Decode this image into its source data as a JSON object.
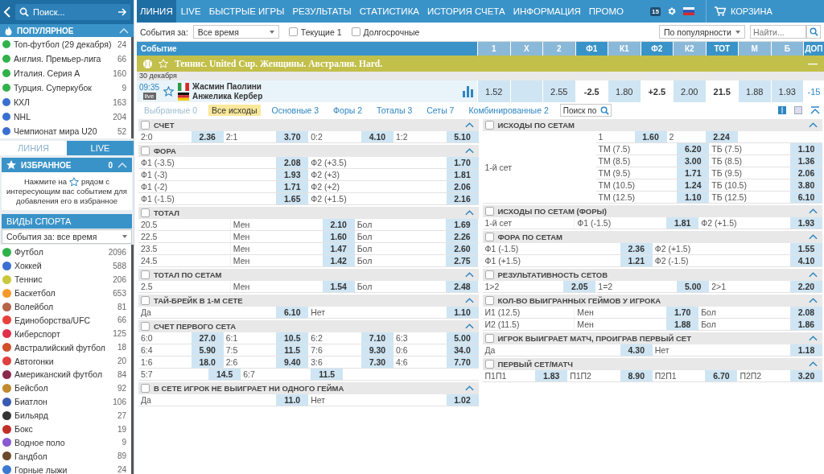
{
  "sidebar": {
    "search": {
      "placeholder": "Поиск..."
    },
    "popular": {
      "title": "ПОПУЛЯРНОЕ",
      "expanded": true,
      "items": [
        {
          "name": "Топ-футбол (29 декабря)",
          "count": "24",
          "color": "#2fb24a"
        },
        {
          "name": "Англия. Премьер-лига",
          "count": "66",
          "color": "#2fb24a"
        },
        {
          "name": "Италия. Серия А",
          "count": "160",
          "color": "#2fb24a"
        },
        {
          "name": "Турция. Суперкубок",
          "count": "9",
          "color": "#2fb24a"
        },
        {
          "name": "КХЛ",
          "count": "163",
          "color": "#3a6fd0"
        },
        {
          "name": "NHL",
          "count": "204",
          "color": "#3a6fd0"
        },
        {
          "name": "Чемпионат мира U20",
          "count": "52",
          "color": "#3a6fd0"
        }
      ]
    },
    "tabs": [
      {
        "label": "ЛИНИЯ",
        "selected": true
      },
      {
        "label": "LIVE",
        "selected": false
      }
    ],
    "favorites": {
      "title": "ИЗБРАННОЕ",
      "count": "0",
      "expanded": true,
      "hint_before": "Нажмите на",
      "hint_middle": "рядом с",
      "hint_after": "интересующим вас событием для добавления его в избранное"
    },
    "sports": {
      "title": "ВИДЫ СПОРТА",
      "period": "События за: все время",
      "items": [
        {
          "name": "Футбол",
          "count": "2096",
          "color": "#2fb24a"
        },
        {
          "name": "Хоккей",
          "count": "588",
          "color": "#3a6fd0"
        },
        {
          "name": "Теннис",
          "count": "206",
          "color": "#c8c83a"
        },
        {
          "name": "Баскетбол",
          "count": "653",
          "color": "#f59a2a"
        },
        {
          "name": "Волейбол",
          "count": "81",
          "color": "#b5654a"
        },
        {
          "name": "Единоборства/UFC",
          "count": "66",
          "color": "#e8403a"
        },
        {
          "name": "Киберспорт",
          "count": "125",
          "color": "#e0304a"
        },
        {
          "name": "Австралийский футбол",
          "count": "18",
          "color": "#d0502a"
        },
        {
          "name": "Автогонки",
          "count": "20",
          "color": "#e04040"
        },
        {
          "name": "Американский футбол",
          "count": "84",
          "color": "#8a2a4a"
        },
        {
          "name": "Бейсбол",
          "count": "92",
          "color": "#c08a30"
        },
        {
          "name": "Биатлон",
          "count": "106",
          "color": "#3a5ab0"
        },
        {
          "name": "Бильярд",
          "count": "27",
          "color": "#333333"
        },
        {
          "name": "Бокс",
          "count": "19",
          "color": "#c0302a"
        },
        {
          "name": "Водное поло",
          "count": "9",
          "color": "#8a5ad0"
        },
        {
          "name": "Гандбол",
          "count": "89",
          "color": "#6a4a2a"
        },
        {
          "name": "Горные лыжи",
          "count": "24",
          "color": "#3a7ad0"
        }
      ]
    }
  },
  "nav": {
    "items": [
      {
        "label": "ЛИНИЯ",
        "selected": true
      },
      {
        "label": "LIVE",
        "selected": false
      },
      {
        "label": "БЫСТРЫЕ ИГРЫ",
        "selected": false
      },
      {
        "label": "РЕЗУЛЬТАТЫ",
        "selected": false
      },
      {
        "label": "СТАТИСТИКА",
        "selected": false
      },
      {
        "label": "ИСТОРИЯ СЧЕТА",
        "selected": false
      },
      {
        "label": "ИНФОРМАЦИЯ",
        "selected": false
      },
      {
        "label": "ПРОМО",
        "selected": false
      }
    ],
    "date_badge": "15",
    "cart": "КОРЗИНА"
  },
  "filter": {
    "period_label": "События за:",
    "period": "Все время",
    "checks": [
      {
        "label": "Текущие 1",
        "checked": false
      },
      {
        "label": "Долгосрочные",
        "checked": false
      }
    ],
    "sort": "По популярности",
    "search_placeholder": "Найти..."
  },
  "table": {
    "event_header": "Событие",
    "columns": [
      {
        "label": "1",
        "kind": "odd"
      },
      {
        "label": "X",
        "kind": "odd"
      },
      {
        "label": "2",
        "kind": "odd"
      },
      {
        "label": "Ф1",
        "kind": "param"
      },
      {
        "label": "К1",
        "kind": "odd"
      },
      {
        "label": "Ф2",
        "kind": "param"
      },
      {
        "label": "К2",
        "kind": "odd"
      },
      {
        "label": "ТОТ",
        "kind": "param"
      },
      {
        "label": "М",
        "kind": "odd"
      },
      {
        "label": "Б",
        "kind": "odd"
      },
      {
        "label": "ДОП",
        "kind": "param"
      }
    ],
    "league": {
      "title": "Теннис. United Cup. Женщины. Австралия. Hard.",
      "collapse": "—"
    },
    "date": "30 декабря",
    "event": {
      "time": "09:35",
      "live": "live",
      "team1": "Жасмин Паолини",
      "team2": "Анжелика Кербер",
      "cells": [
        {
          "text": "1.52",
          "kind": "odd"
        },
        {
          "kind": "empty"
        },
        {
          "text": "2.55",
          "kind": "odd"
        },
        {
          "text": "-2.5",
          "kind": "param"
        },
        {
          "text": "1.80",
          "kind": "odd"
        },
        {
          "text": "+2.5",
          "kind": "param"
        },
        {
          "text": "2.00",
          "kind": "odd"
        },
        {
          "text": "21.5",
          "kind": "param"
        },
        {
          "text": "1.88",
          "kind": "odd"
        },
        {
          "text": "1.93",
          "kind": "odd"
        },
        {
          "text": "-15",
          "kind": "more"
        }
      ]
    }
  },
  "market_tabs": [
    {
      "label": "Выбранные 0",
      "selected": false,
      "disabled": true
    },
    {
      "label": "Все исходы",
      "selected": true,
      "disabled": false
    },
    {
      "label": "Основные 3",
      "selected": false,
      "disabled": false
    },
    {
      "label": "Форы 2",
      "selected": false,
      "disabled": false
    },
    {
      "label": "Тоталы 3",
      "selected": false,
      "disabled": false
    },
    {
      "label": "Сеты 7",
      "selected": false,
      "disabled": false
    },
    {
      "label": "Комбинированные 2",
      "selected": false,
      "disabled": false
    }
  ],
  "market_search": {
    "placeholder": "Поиск по"
  },
  "markets": {
    "left": [
      {
        "title": "СЧЕТ",
        "checked": false,
        "expanded": true,
        "rows": [
          [
            {
              "text": "2:0",
              "kind": "label"
            },
            {
              "text": "2.36",
              "kind": "odd"
            },
            {
              "text": "2:1",
              "kind": "label"
            },
            {
              "text": "3.70",
              "kind": "odd"
            },
            {
              "text": "0:2",
              "kind": "label"
            },
            {
              "text": "4.10",
              "kind": "odd"
            },
            {
              "text": "1:2",
              "kind": "label"
            },
            {
              "text": "5.10",
              "kind": "odd"
            }
          ]
        ]
      },
      {
        "title": "ФОРА",
        "checked": false,
        "expanded": true,
        "rows": [
          [
            {
              "text": "Ф1 (-3.5)",
              "kind": "label"
            },
            {
              "text": "2.08",
              "kind": "odd"
            },
            {
              "text": "Ф2 (+3.5)",
              "kind": "label"
            },
            {
              "text": "1.70",
              "kind": "odd"
            }
          ],
          [
            {
              "text": "Ф1 (-3)",
              "kind": "label"
            },
            {
              "text": "1.93",
              "kind": "odd"
            },
            {
              "text": "Ф2 (+3)",
              "kind": "label"
            },
            {
              "text": "1.81",
              "kind": "odd"
            }
          ],
          [
            {
              "text": "Ф1 (-2)",
              "kind": "label"
            },
            {
              "text": "1.71",
              "kind": "odd"
            },
            {
              "text": "Ф2 (+2)",
              "kind": "label"
            },
            {
              "text": "2.06",
              "kind": "odd"
            }
          ],
          [
            {
              "text": "Ф1 (-1.5)",
              "kind": "label"
            },
            {
              "text": "1.65",
              "kind": "odd"
            },
            {
              "text": "Ф2 (+1.5)",
              "kind": "label"
            },
            {
              "text": "2.16",
              "kind": "odd"
            }
          ]
        ]
      },
      {
        "title": "ТОТАЛ",
        "checked": false,
        "expanded": true,
        "rows": [
          [
            {
              "text": "20.5",
              "kind": "label"
            },
            {
              "text": "Мен",
              "kind": "label"
            },
            {
              "text": "2.10",
              "kind": "odd"
            },
            {
              "text": "Бол",
              "kind": "label"
            },
            {
              "text": "1.69",
              "kind": "odd"
            }
          ],
          [
            {
              "text": "22.5",
              "kind": "label"
            },
            {
              "text": "Мен",
              "kind": "label"
            },
            {
              "text": "1.60",
              "kind": "odd"
            },
            {
              "text": "Бол",
              "kind": "label"
            },
            {
              "text": "2.26",
              "kind": "odd"
            }
          ],
          [
            {
              "text": "23.5",
              "kind": "label"
            },
            {
              "text": "Мен",
              "kind": "label"
            },
            {
              "text": "1.47",
              "kind": "odd"
            },
            {
              "text": "Бол",
              "kind": "label"
            },
            {
              "text": "2.60",
              "kind": "odd"
            }
          ],
          [
            {
              "text": "24.5",
              "kind": "label"
            },
            {
              "text": "Мен",
              "kind": "label"
            },
            {
              "text": "1.42",
              "kind": "odd"
            },
            {
              "text": "Бол",
              "kind": "label"
            },
            {
              "text": "2.75",
              "kind": "odd"
            }
          ]
        ]
      },
      {
        "title": "ТОТАЛ ПО СЕТАМ",
        "checked": false,
        "expanded": true,
        "rows": [
          [
            {
              "text": "2.5",
              "kind": "label"
            },
            {
              "text": "Мен",
              "kind": "label"
            },
            {
              "text": "1.54",
              "kind": "odd"
            },
            {
              "text": "Бол",
              "kind": "label"
            },
            {
              "text": "2.48",
              "kind": "odd"
            }
          ]
        ]
      },
      {
        "title": "ТАЙ-БРЕЙК В 1-М СЕТЕ",
        "checked": false,
        "expanded": true,
        "rows": [
          [
            {
              "text": "Да",
              "kind": "label"
            },
            {
              "text": "6.10",
              "kind": "odd"
            },
            {
              "text": "Нет",
              "kind": "label"
            },
            {
              "text": "1.10",
              "kind": "odd"
            }
          ]
        ]
      },
      {
        "title": "СЧЕТ ПЕРВОГО СЕТА",
        "checked": false,
        "expanded": true,
        "rows": [
          [
            {
              "text": "6:0",
              "kind": "label"
            },
            {
              "text": "27.0",
              "kind": "odd"
            },
            {
              "text": "6:1",
              "kind": "label"
            },
            {
              "text": "10.5",
              "kind": "odd"
            },
            {
              "text": "6:2",
              "kind": "label"
            },
            {
              "text": "7.10",
              "kind": "odd"
            },
            {
              "text": "6:3",
              "kind": "label"
            },
            {
              "text": "5.00",
              "kind": "odd"
            }
          ],
          [
            {
              "text": "6:4",
              "kind": "label"
            },
            {
              "text": "5.90",
              "kind": "odd"
            },
            {
              "text": "7:5",
              "kind": "label"
            },
            {
              "text": "11.5",
              "kind": "odd"
            },
            {
              "text": "7:6",
              "kind": "label"
            },
            {
              "text": "9.30",
              "kind": "odd"
            },
            {
              "text": "0:6",
              "kind": "label"
            },
            {
              "text": "34.0",
              "kind": "odd"
            }
          ],
          [
            {
              "text": "1:6",
              "kind": "label"
            },
            {
              "text": "18.0",
              "kind": "odd"
            },
            {
              "text": "2:6",
              "kind": "label"
            },
            {
              "text": "9.40",
              "kind": "odd"
            },
            {
              "text": "3:6",
              "kind": "label"
            },
            {
              "text": "7.30",
              "kind": "odd"
            },
            {
              "text": "4:6",
              "kind": "label"
            },
            {
              "text": "7.70",
              "kind": "odd"
            }
          ],
          [
            {
              "text": "5:7",
              "kind": "label"
            },
            {
              "text": "14.5",
              "kind": "odd"
            },
            {
              "text": "6:7",
              "kind": "label"
            },
            {
              "text": "11.5",
              "kind": "odd"
            },
            {
              "kind": "blank"
            }
          ]
        ]
      },
      {
        "title": "В СЕТЕ ИГРОК НЕ ВЫИГРАЕТ НИ ОДНОГО ГЕЙМА",
        "checked": false,
        "expanded": true,
        "rows": [
          [
            {
              "text": "Да",
              "kind": "label"
            },
            {
              "text": "11.0",
              "kind": "odd"
            },
            {
              "text": "Нет",
              "kind": "label"
            },
            {
              "text": "1.02",
              "kind": "odd"
            }
          ]
        ]
      }
    ],
    "right": [
      {
        "title": "ИСХОДЫ ПО СЕТАМ",
        "checked": false,
        "expanded": true,
        "side_label": "1-й сет",
        "head_row": [
          {
            "text": "1",
            "kind": "label"
          },
          {
            "text": "1.60",
            "kind": "odd"
          },
          {
            "text": "2",
            "kind": "label"
          },
          {
            "text": "2.24",
            "kind": "odd"
          }
        ],
        "rows": [
          [
            {
              "text": "ТМ (7.5)",
              "kind": "label"
            },
            {
              "text": "6.20",
              "kind": "odd"
            },
            {
              "text": "ТБ (7.5)",
              "kind": "label"
            },
            {
              "text": "1.10",
              "kind": "odd"
            }
          ],
          [
            {
              "text": "ТМ (8.5)",
              "kind": "label"
            },
            {
              "text": "3.00",
              "kind": "odd"
            },
            {
              "text": "ТБ (8.5)",
              "kind": "label"
            },
            {
              "text": "1.36",
              "kind": "odd"
            }
          ],
          [
            {
              "text": "ТМ (9.5)",
              "kind": "label"
            },
            {
              "text": "1.71",
              "kind": "odd"
            },
            {
              "text": "ТБ (9.5)",
              "kind": "label"
            },
            {
              "text": "2.06",
              "kind": "odd"
            }
          ],
          [
            {
              "text": "ТМ (10.5)",
              "kind": "label"
            },
            {
              "text": "1.24",
              "kind": "odd"
            },
            {
              "text": "ТБ (10.5)",
              "kind": "label"
            },
            {
              "text": "3.80",
              "kind": "odd"
            }
          ],
          [
            {
              "text": "ТМ (12.5)",
              "kind": "label"
            },
            {
              "text": "1.10",
              "kind": "odd"
            },
            {
              "text": "ТБ (12.5)",
              "kind": "label"
            },
            {
              "text": "6.10",
              "kind": "odd"
            }
          ]
        ]
      },
      {
        "title": "ИСХОДЫ ПО СЕТАМ (ФОРЫ)",
        "checked": false,
        "expanded": true,
        "rows": [
          [
            {
              "text": "1-й сет",
              "kind": "label"
            },
            {
              "text": "Ф1 (-1.5)",
              "kind": "label"
            },
            {
              "text": "1.81",
              "kind": "odd"
            },
            {
              "text": "Ф2 (+1.5)",
              "kind": "label"
            },
            {
              "text": "1.93",
              "kind": "odd"
            }
          ]
        ]
      },
      {
        "title": "ФОРА ПО СЕТАМ",
        "checked": false,
        "expanded": true,
        "rows": [
          [
            {
              "text": "Ф1 (-1.5)",
              "kind": "label"
            },
            {
              "text": "2.36",
              "kind": "odd"
            },
            {
              "text": "Ф2 (+1.5)",
              "kind": "label"
            },
            {
              "text": "1.55",
              "kind": "odd"
            }
          ],
          [
            {
              "text": "Ф1 (+1.5)",
              "kind": "label"
            },
            {
              "text": "1.21",
              "kind": "odd"
            },
            {
              "text": "Ф2 (-1.5)",
              "kind": "label"
            },
            {
              "text": "4.10",
              "kind": "odd"
            }
          ]
        ]
      },
      {
        "title": "РЕЗУЛЬТАТИВНОСТЬ СЕТОВ",
        "checked": false,
        "expanded": true,
        "rows": [
          [
            {
              "text": "1>2",
              "kind": "label"
            },
            {
              "text": "2.05",
              "kind": "odd"
            },
            {
              "text": "1=2",
              "kind": "label"
            },
            {
              "text": "5.00",
              "kind": "odd"
            },
            {
              "text": "2>1",
              "kind": "label"
            },
            {
              "text": "2.20",
              "kind": "odd"
            }
          ]
        ]
      },
      {
        "title": "КОЛ-ВО ВЫИГРАННЫХ ГЕЙМОВ У ИГРОКА",
        "checked": false,
        "expanded": true,
        "rows": [
          [
            {
              "text": "И1 (12.5)",
              "kind": "label"
            },
            {
              "text": "Мен",
              "kind": "label"
            },
            {
              "text": "1.70",
              "kind": "odd"
            },
            {
              "text": "Бол",
              "kind": "label"
            },
            {
              "text": "2.08",
              "kind": "odd"
            }
          ],
          [
            {
              "text": "И2 (11.5)",
              "kind": "label"
            },
            {
              "text": "Мен",
              "kind": "label"
            },
            {
              "text": "1.88",
              "kind": "odd"
            },
            {
              "text": "Бол",
              "kind": "label"
            },
            {
              "text": "1.86",
              "kind": "odd"
            }
          ]
        ]
      },
      {
        "title": "ИГРОК ВЫИГРАЕТ МАТЧ, ПРОИГРАВ ПЕРВЫЙ СЕТ",
        "checked": false,
        "expanded": true,
        "rows": [
          [
            {
              "text": "Да",
              "kind": "label"
            },
            {
              "text": "4.30",
              "kind": "odd"
            },
            {
              "text": "Нет",
              "kind": "label"
            },
            {
              "text": "1.18",
              "kind": "odd"
            }
          ]
        ]
      },
      {
        "title": "ПЕРВЫЙ СЕТ/МАТЧ",
        "checked": false,
        "expanded": true,
        "rows": [
          [
            {
              "text": "П1П1",
              "kind": "label"
            },
            {
              "text": "1.83",
              "kind": "odd"
            },
            {
              "text": "П1П2",
              "kind": "label"
            },
            {
              "text": "8.90",
              "kind": "odd"
            },
            {
              "text": "П2П1",
              "kind": "label"
            },
            {
              "text": "6.70",
              "kind": "odd"
            },
            {
              "text": "П2П2",
              "kind": "label"
            },
            {
              "text": "3.20",
              "kind": "odd"
            }
          ]
        ]
      }
    ]
  }
}
